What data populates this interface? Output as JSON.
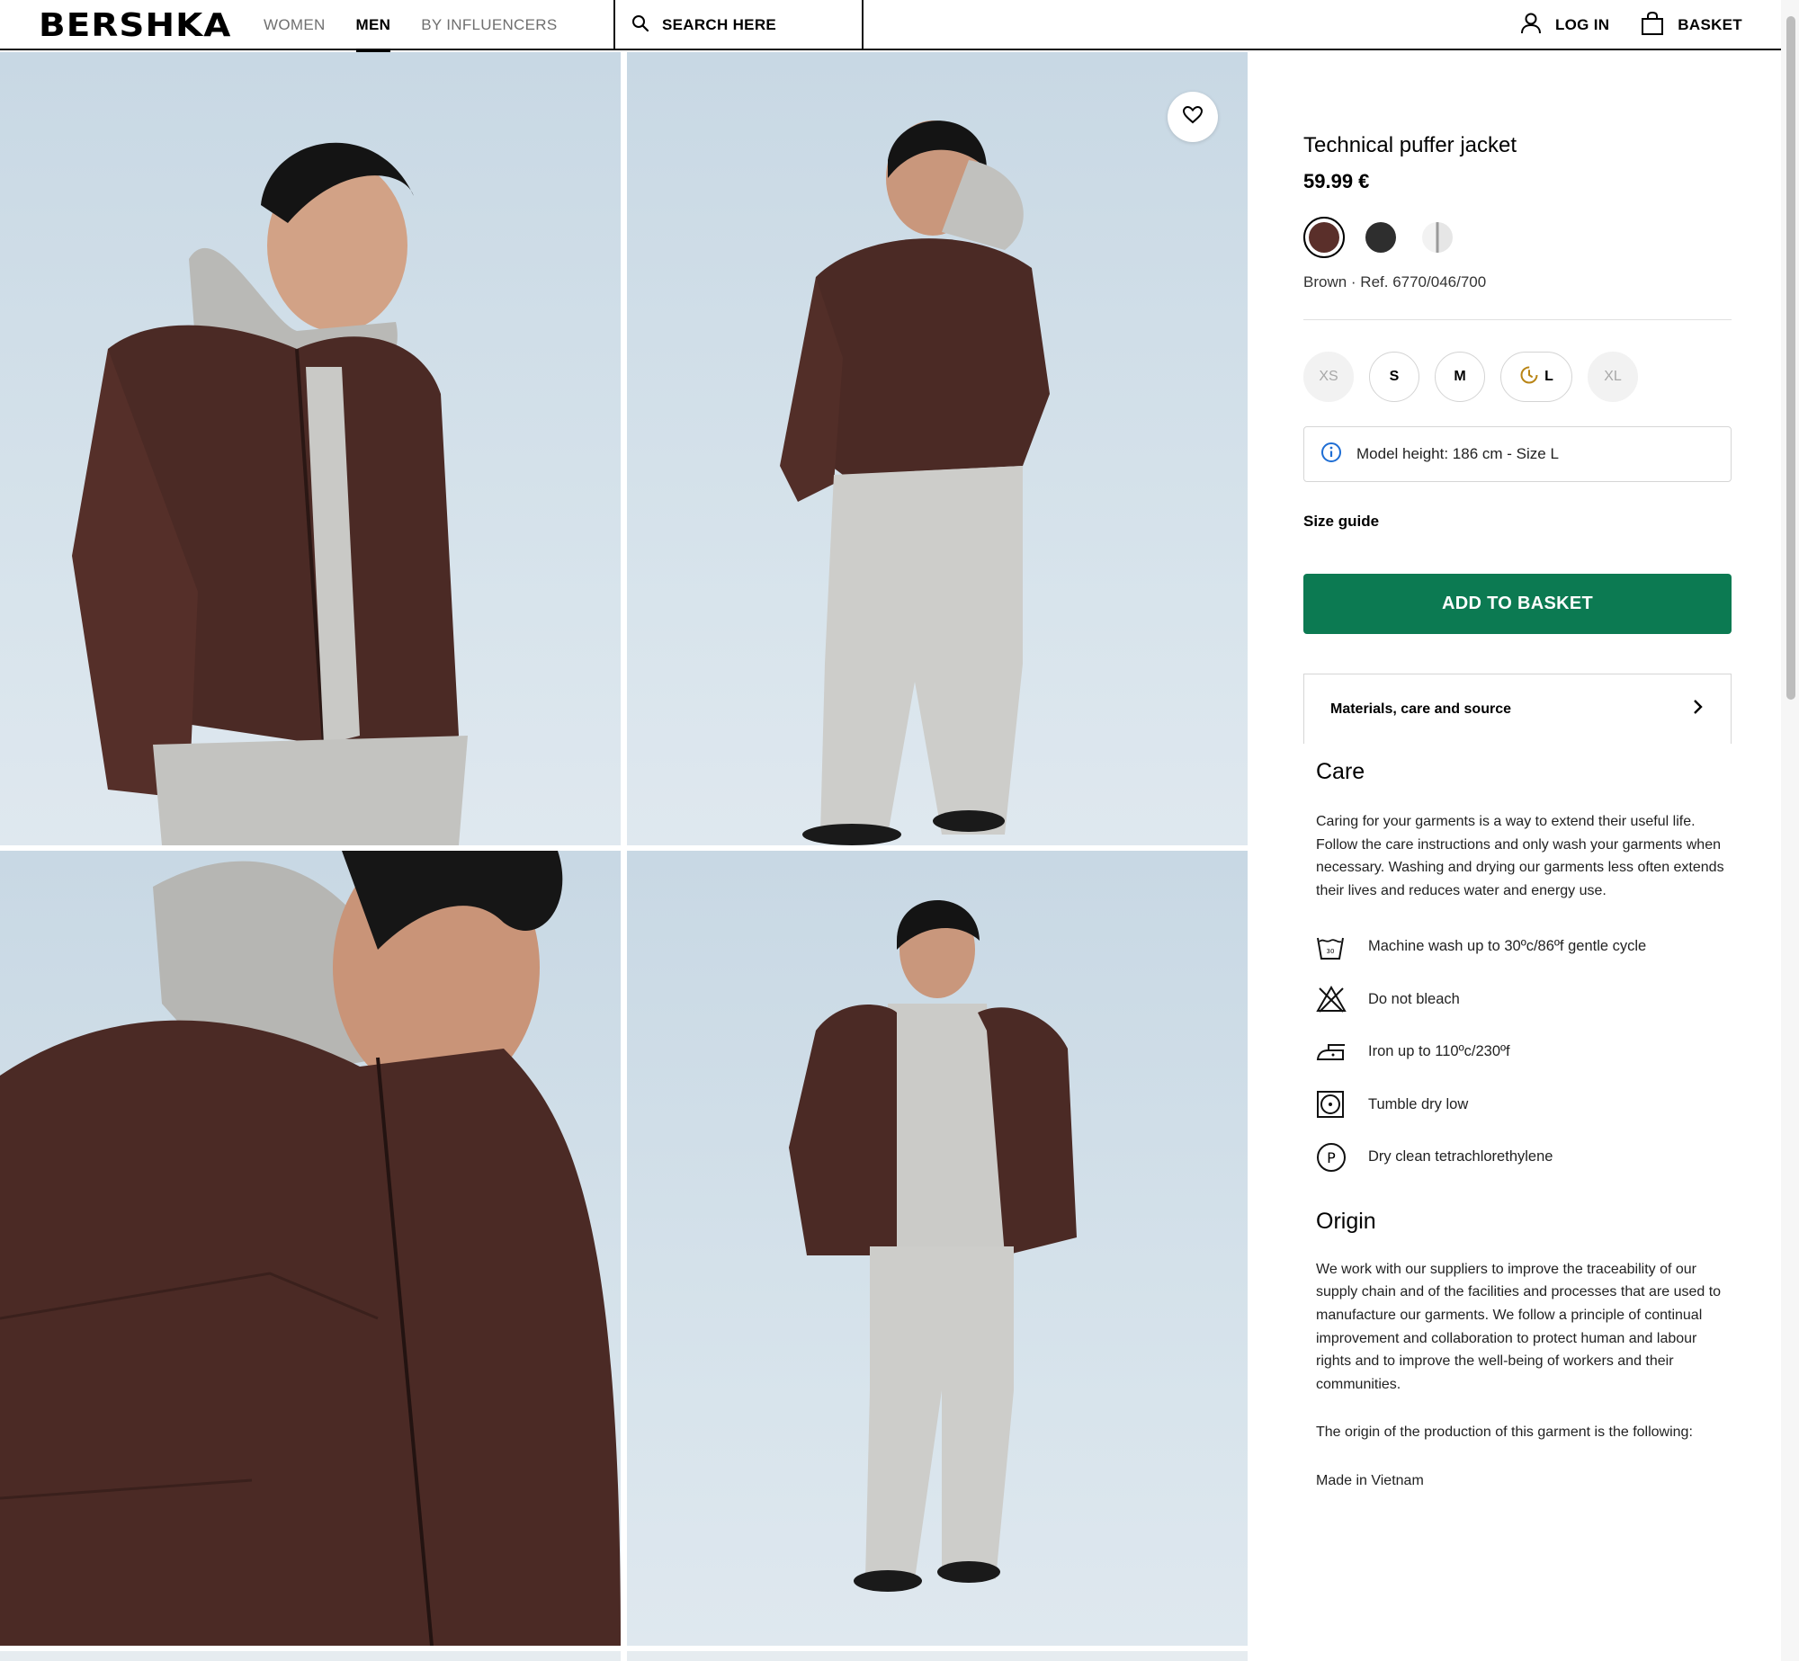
{
  "header": {
    "logo": "BERSHKA",
    "nav": [
      {
        "label": "WOMEN",
        "active": false
      },
      {
        "label": "MEN",
        "active": true
      },
      {
        "label": "BY INFLUENCERS",
        "active": false
      }
    ],
    "search_label": "SEARCH HERE",
    "login_label": "LOG IN",
    "basket_label": "BASKET"
  },
  "icons": {
    "search": "search-icon",
    "user": "user-icon",
    "basket": "basket-icon",
    "favorite": "heart-icon",
    "info": "info-icon",
    "chevron": "chevron-right-icon",
    "clock": "clock-icon"
  },
  "product": {
    "title": "Technical puffer jacket",
    "price": "59.99 €",
    "colors": [
      {
        "name": "brown",
        "hex": "#5a2f2a",
        "selected": true
      },
      {
        "name": "black",
        "hex": "#2e2e2e",
        "selected": false
      },
      {
        "name": "white-grey",
        "hex": "#e2e2e2",
        "selected": false
      }
    ],
    "ref": "Brown · Ref. 6770/046/700",
    "sizes": [
      {
        "label": "XS",
        "available": false
      },
      {
        "label": "S",
        "available": true
      },
      {
        "label": "M",
        "available": true
      },
      {
        "label": "L",
        "available": true,
        "low_stock": true
      },
      {
        "label": "XL",
        "available": false
      }
    ],
    "model_info": "Model height: 186 cm - Size L",
    "size_guide": "Size guide",
    "add_to_basket": "ADD TO BASKET",
    "materials_label": "Materials, care and source",
    "accent_color": "#0c7a52"
  },
  "care": {
    "title": "Care",
    "text": "Caring for your garments is a way to extend their useful life. Follow the care instructions and only wash your garments when necessary. Washing and drying our garments less often extends their lives and reduces water and energy use.",
    "instructions": [
      {
        "icon": "machine-wash-icon",
        "text": "Machine wash up to 30ºc/86ºf gentle cycle"
      },
      {
        "icon": "do-not-bleach-icon",
        "text": "Do not bleach"
      },
      {
        "icon": "iron-icon",
        "text": "Iron up to 110ºc/230ºf"
      },
      {
        "icon": "tumble-dry-icon",
        "text": "Tumble dry low"
      },
      {
        "icon": "dry-clean-icon",
        "text": "Dry clean tetrachlorethylene"
      }
    ]
  },
  "origin": {
    "title": "Origin",
    "text1": "We work with our suppliers to improve the traceability of our supply chain and of the facilities and processes that are used to manufacture our garments. We follow a principle of continual improvement and collaboration to protect human and labour rights and to improve the well-being of workers and their communities.",
    "text2": "The origin of the production of this garment is the following:",
    "made_in": "Made in Vietnam"
  }
}
